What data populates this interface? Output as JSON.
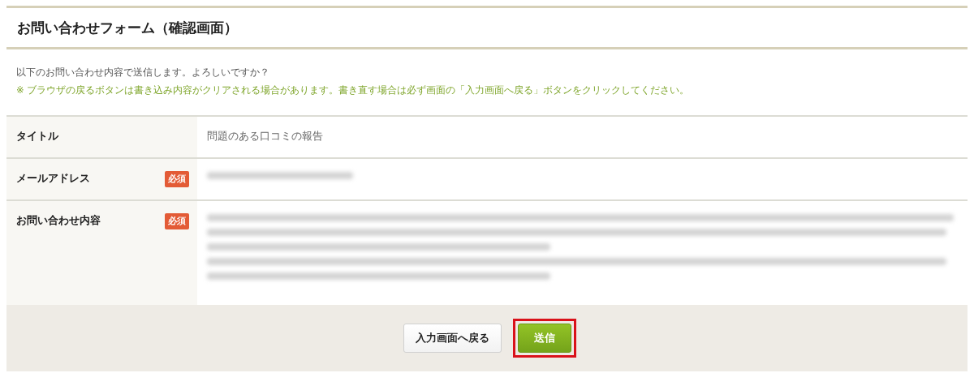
{
  "page": {
    "title": "お問い合わせフォーム（確認画面）"
  },
  "intro": "以下のお問い合わせ内容で送信します。よろしいですか？",
  "notice": "※ ブラウザの戻るボタンは書き込み内容がクリアされる場合があります。書き直す場合は必ず画面の「入力画面へ戻る」ボタンをクリックしてください。",
  "fields": [
    {
      "label": "タイトル",
      "required": false,
      "value": "問題のある口コミの報告"
    },
    {
      "label": "メールアドレス",
      "required": true,
      "required_badge": "必須",
      "redacted": true,
      "kind": "short"
    },
    {
      "label": "お問い合わせ内容",
      "required": true,
      "required_badge": "必須",
      "redacted": true,
      "kind": "long"
    }
  ],
  "buttons": [
    {
      "label": "入力画面へ戻る",
      "kind": "secondary",
      "highlighted": false
    },
    {
      "label": "送信",
      "kind": "primary",
      "highlighted": true
    }
  ]
}
